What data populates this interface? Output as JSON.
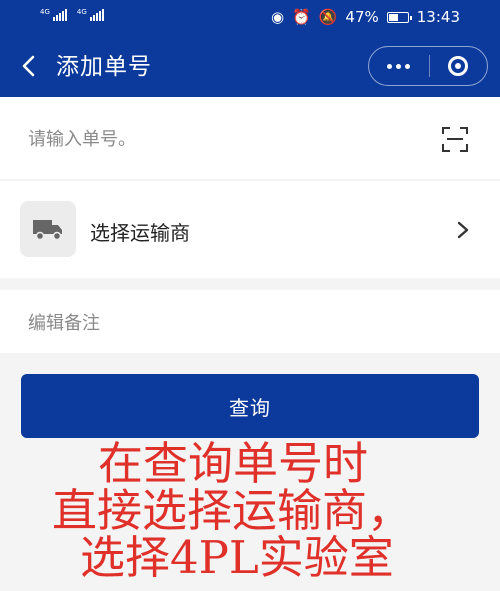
{
  "status_bar": {
    "signal_1": "4G",
    "signal_2": "4G",
    "battery_percent": "47%",
    "time": "13:43",
    "icons": [
      "eye-icon",
      "alarm-icon",
      "mute-icon",
      "battery-icon"
    ]
  },
  "header": {
    "title": "添加单号",
    "back_icon": "chevron-left-icon",
    "capsule_icons": [
      "more-dots-icon",
      "close-target-icon"
    ],
    "color": "#0b3a9c"
  },
  "form": {
    "number_placeholder": "请输入单号。",
    "scan_icon": "scan-icon",
    "carrier_label": "选择运输商",
    "carrier_icon": "truck-icon",
    "remark_placeholder": "编辑备注"
  },
  "query_button": {
    "label": "查询"
  },
  "annotation": {
    "lines": [
      "在查询单号时",
      "直接选择运输商，",
      "选择4PL实验室"
    ],
    "color": "#e0302a"
  }
}
